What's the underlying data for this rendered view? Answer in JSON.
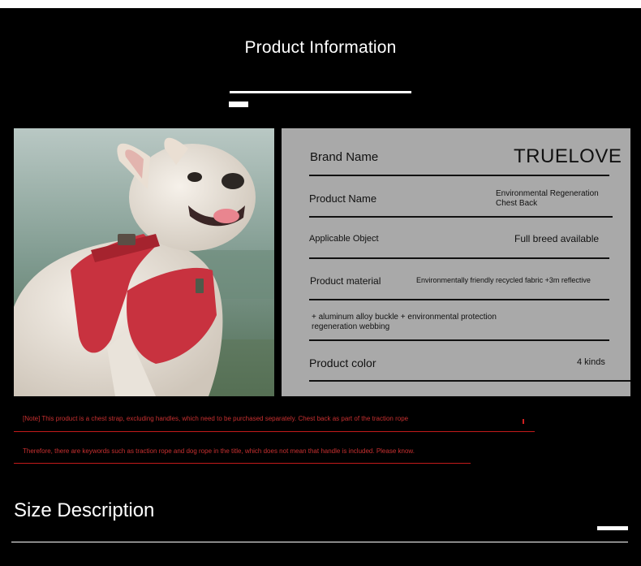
{
  "header": {
    "title": "Product Information"
  },
  "info": {
    "brand_label": "Brand Name",
    "brand_value": "TRUELOVE",
    "product_name_label": "Product Name",
    "product_name_value_line1": "Environmental Regeneration",
    "product_name_value_line2": "Chest Back",
    "applicable_label": "Applicable Object",
    "applicable_value": "Full breed available",
    "material_label": "Product material",
    "material_value": "Environmentally friendly recycled fabric +3m reflective",
    "material_cont_line1": "+ aluminum alloy buckle + environmental protection",
    "material_cont_line2": "regeneration webbing",
    "color_label": "Product color",
    "color_value": "4 kinds"
  },
  "notes": {
    "note1": "[Note] This product is a chest strap, excluding handles, which need to be purchased separately. Chest back as part of the traction rope",
    "note2": "Therefore, there are keywords such as traction rope and dog rope in the title, which does not mean that handle is included. Please know."
  },
  "size": {
    "title": "Size Description"
  },
  "colors": {
    "background": "#000000",
    "panel": "#a9a9a9",
    "harness": "#c8323f",
    "note_red": "#c83030"
  }
}
